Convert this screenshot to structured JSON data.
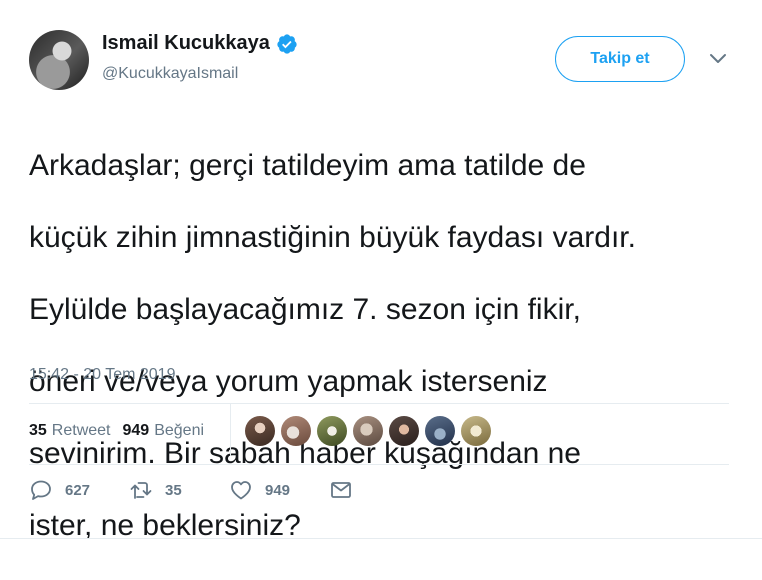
{
  "author": {
    "name": "Ismail Kucukkaya",
    "handle": "@KucukkayaIsmail",
    "verified": true
  },
  "follow_button": "Takip et",
  "tweet": {
    "lines": [
      "Arkadaşlar; gerçi tatildeyim ama tatilde de",
      "küçük zihin jimnastiğinin büyük faydası vardır.",
      "Eylülde başlayacağımız 7. sezon için fikir,",
      "öneri ve/veya yorum yapmak isterseniz",
      "sevinirim. Bir sabah haber kuşağından ne",
      "ister, ne beklersiniz?"
    ],
    "timestamp": "15:42 - 20 Tem 2019"
  },
  "stats": {
    "retweets_count": "35",
    "retweets_label": "Retweet",
    "likes_count": "949",
    "likes_label": "Beğeni"
  },
  "likers": [
    {
      "name": "liker-1",
      "color": "#7a5a4a"
    },
    {
      "name": "liker-2",
      "color": "#b08a78"
    },
    {
      "name": "liker-3",
      "color": "#8f9a5e"
    },
    {
      "name": "liker-4",
      "color": "#a89080"
    },
    {
      "name": "liker-5",
      "color": "#5a4a44"
    },
    {
      "name": "liker-6",
      "color": "#5a6e8a"
    },
    {
      "name": "liker-7",
      "color": "#c7b98a"
    }
  ],
  "actions": {
    "reply_count": "627",
    "retweet_count": "35",
    "like_count": "949"
  },
  "colors": {
    "accent": "#1da1f2",
    "text": "#14171a",
    "secondary": "#657786"
  }
}
